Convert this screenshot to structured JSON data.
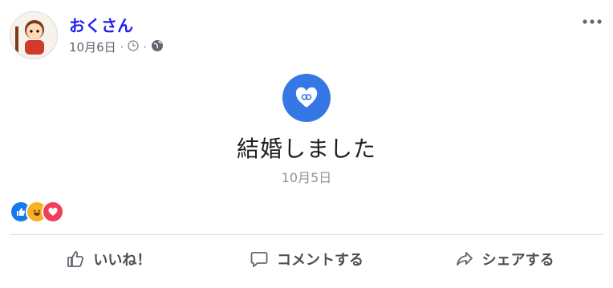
{
  "post": {
    "author": "おくさん",
    "date": "10月6日",
    "sep": "·",
    "icons": [
      "avatar",
      "clock-icon",
      "globe-icon",
      "more-icon"
    ]
  },
  "event": {
    "icon": "heart-rings-icon",
    "title": "結婚しました",
    "date": "10月5日",
    "accent": "#3578e5"
  },
  "reactions": {
    "types": [
      "like-icon",
      "haha-icon",
      "love-icon"
    ],
    "colors": {
      "like": "#1877f2",
      "haha": "#f7b125",
      "love": "#f33e58"
    },
    "names_blurred": "　　　　　　　　　　　　　　　　",
    "comments_blurred": "　　　　　"
  },
  "actions": [
    {
      "label": "いいね！",
      "icon": "thumbs-up-icon"
    },
    {
      "label": "コメントする",
      "icon": "comment-icon"
    },
    {
      "label": "シェアする",
      "icon": "share-icon"
    }
  ]
}
